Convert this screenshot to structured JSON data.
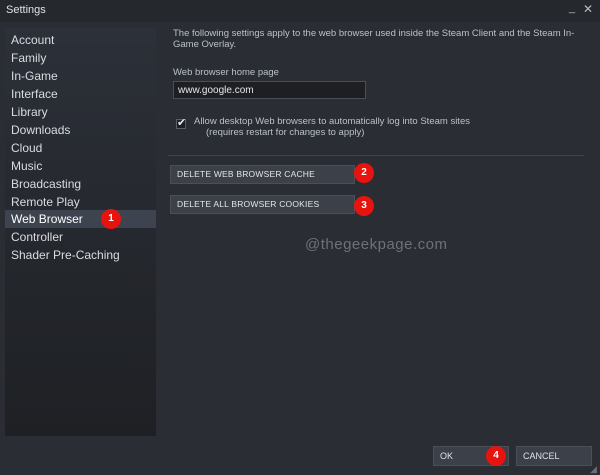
{
  "window": {
    "title": "Settings",
    "minimize_glyph": "_",
    "close_glyph": "✕"
  },
  "sidebar": {
    "items": [
      {
        "label": "Account"
      },
      {
        "label": "Family"
      },
      {
        "label": "In-Game"
      },
      {
        "label": "Interface"
      },
      {
        "label": "Library"
      },
      {
        "label": "Downloads"
      },
      {
        "label": "Cloud"
      },
      {
        "label": "Music"
      },
      {
        "label": "Broadcasting"
      },
      {
        "label": "Remote Play"
      },
      {
        "label": "Web Browser",
        "active": true
      },
      {
        "label": "Controller"
      },
      {
        "label": "Shader Pre-Caching"
      }
    ]
  },
  "web_browser": {
    "description": "The following settings apply to the web browser used inside the Steam Client and the Steam In-Game Overlay.",
    "home_page_label": "Web browser home page",
    "home_page_value": "www.google.com",
    "auto_login_line1": "Allow desktop Web browsers to automatically log into Steam sites",
    "auto_login_line2": "(requires restart for changes to apply)",
    "auto_login_checked": true,
    "delete_cache_label": "DELETE WEB BROWSER CACHE",
    "delete_cookies_label": "DELETE ALL BROWSER COOKIES"
  },
  "annotations": {
    "badge1": "1",
    "badge2": "2",
    "badge3": "3",
    "badge4": "4",
    "badge_color": "#e6130f"
  },
  "watermark": "@thegeekpage.com",
  "footer": {
    "ok_label": "OK",
    "cancel_label": "CANCEL"
  },
  "colors": {
    "background": "#2a2d33",
    "sidebar_active": "#3d4450",
    "button": "#3c4048"
  }
}
